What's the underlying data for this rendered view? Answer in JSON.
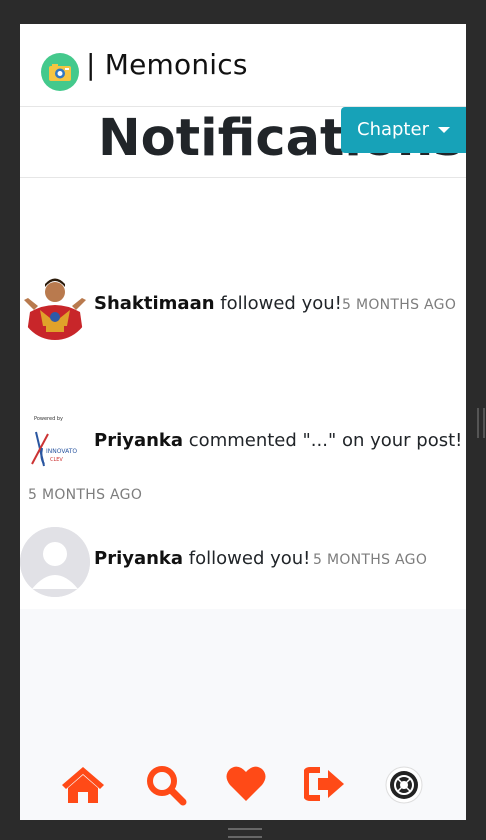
{
  "app": {
    "brand": "| Memonics"
  },
  "page": {
    "title": "Notifications"
  },
  "chapter_button": {
    "label": "Chapter"
  },
  "notifications": [
    {
      "user": "Shaktimaan",
      "message": " followed you!",
      "time": "5 MONTHS AGO",
      "avatar": "shaktimaan-avatar"
    },
    {
      "user": "Priyanka",
      "message": " commented \"...\" on your post!",
      "time": "5 MONTHS AGO",
      "avatar": "notionpress-logo-avatar"
    },
    {
      "user": "Priyanka",
      "message": " followed you!",
      "time": "5 MONTHS AGO",
      "avatar": "default-user-avatar"
    }
  ],
  "nav": [
    {
      "icon": "home-icon"
    },
    {
      "icon": "search-icon"
    },
    {
      "icon": "heart-icon"
    },
    {
      "icon": "sign-out-icon"
    },
    {
      "icon": "profile-avatar-icon"
    }
  ],
  "colors": {
    "accent": "#ff4a17",
    "chapter_button": "#17a2b8",
    "logo": "#44c98c"
  }
}
